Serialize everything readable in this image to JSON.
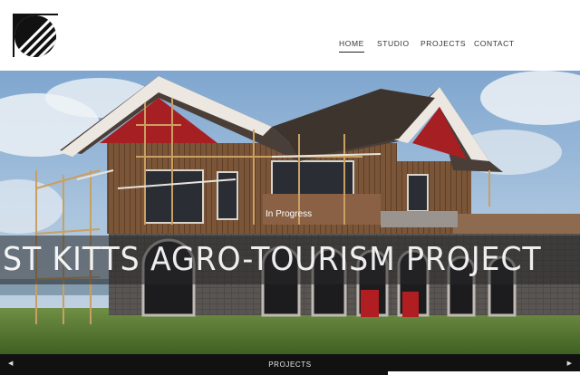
{
  "header": {
    "logo_icon": "diagonal-stripes-logo-icon",
    "nav": {
      "home": "HOME",
      "studio": "STUDIO",
      "projects": "PROJECTS",
      "contact": "CONTACT"
    },
    "active_item": "HOME"
  },
  "hero": {
    "status": "In Progress",
    "title": "ST KITTS AGRO-TOURISM PROJECT"
  },
  "footer": {
    "label": "PROJECTS",
    "prev_icon": "triangle-left-icon",
    "next_icon": "triangle-right-icon"
  },
  "colors": {
    "roof": "#4a3f38",
    "gable_red": "#a51f23",
    "wood": "#7a5236",
    "stone": "#4e4b48",
    "sky": "#8fb3d6",
    "grass": "#5b7e34",
    "bar": "#111111"
  }
}
